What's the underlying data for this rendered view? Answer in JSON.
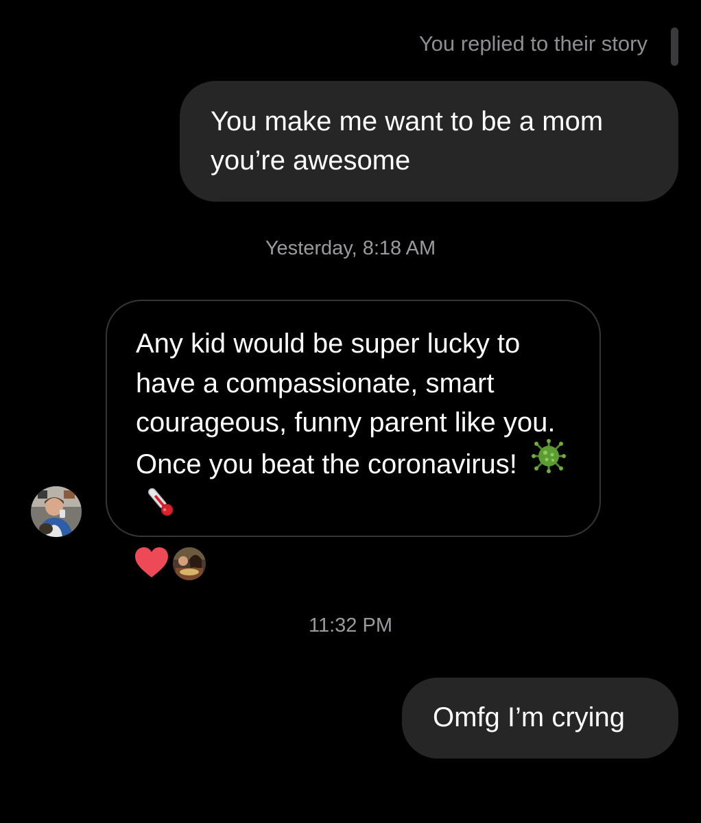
{
  "thread": {
    "story_reply_note": "You replied to their story",
    "messages": [
      {
        "direction": "outgoing",
        "text": "You make me want to be a mom you’re awesome"
      },
      {
        "timestamp": "Yesterday, 8:18 AM"
      },
      {
        "direction": "incoming",
        "text": "Any kid would be super lucky to have a compassionate, smart courageous, funny parent like you. Once you beat the coronavirus!",
        "emojis": [
          "microbe-icon",
          "thermometer-icon"
        ],
        "reactions": [
          "heart-icon"
        ]
      },
      {
        "timestamp": "11:32 PM"
      },
      {
        "direction": "outgoing",
        "text": "Omfg I’m crying"
      }
    ]
  },
  "colors": {
    "background": "#000000",
    "outgoing_bubble": "#262626",
    "incoming_border": "#363636",
    "meta_text": "#8e8e93",
    "heart": "#ed4956"
  }
}
